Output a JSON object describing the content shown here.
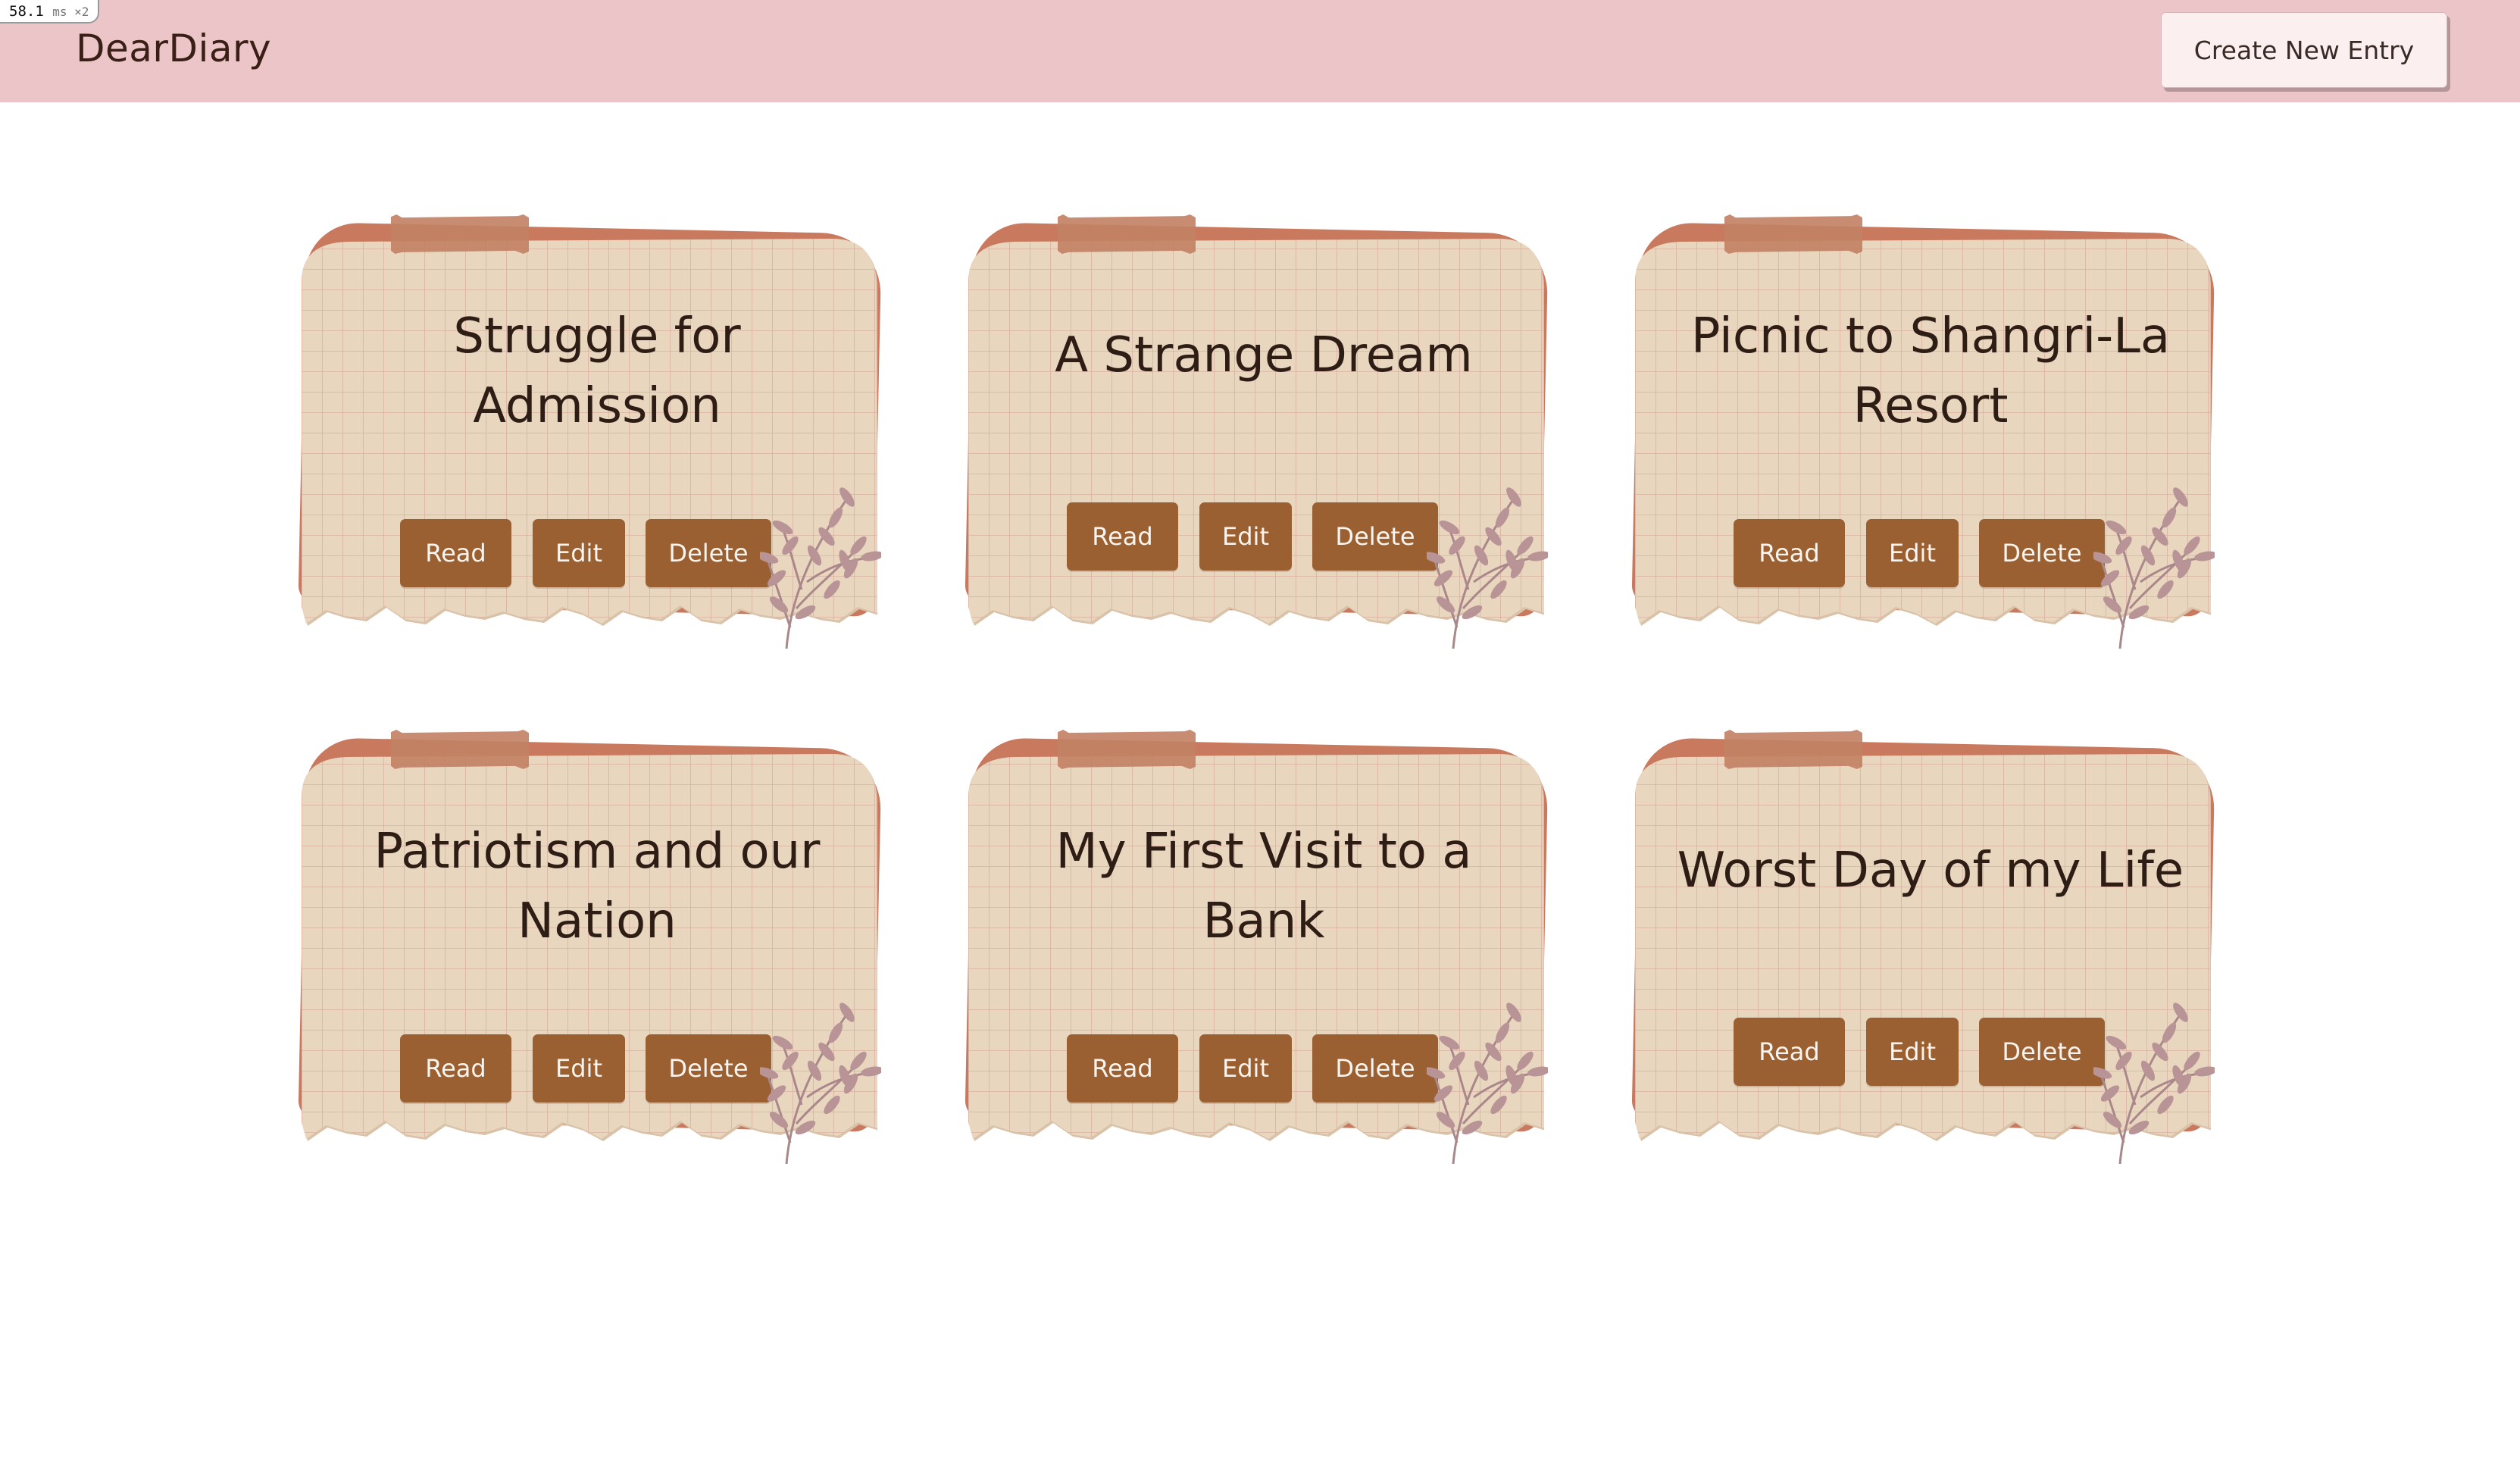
{
  "perf": {
    "value": "58.1",
    "unit": "ms ×2"
  },
  "navbar": {
    "brand": "DearDiary",
    "create_label": "Create New Entry"
  },
  "entries": [
    {
      "title": "Struggle for Admission",
      "read": "Read",
      "edit": "Edit",
      "delete": "Delete"
    },
    {
      "title": "A Strange Dream",
      "read": "Read",
      "edit": "Edit",
      "delete": "Delete"
    },
    {
      "title": "Picnic to Shangri-La Resort",
      "read": "Read",
      "edit": "Edit",
      "delete": "Delete"
    },
    {
      "title": "Patriotism and our Nation",
      "read": "Read",
      "edit": "Edit",
      "delete": "Delete"
    },
    {
      "title": "My First Visit to a Bank",
      "read": "Read",
      "edit": "Edit",
      "delete": "Delete"
    },
    {
      "title": "Worst Day of my Life",
      "read": "Read",
      "edit": "Edit",
      "delete": "Delete"
    }
  ],
  "colors": {
    "navbar_bg": "#ecc5c8",
    "paper_bg": "#e9d6bf",
    "grid_line": "#d7a99b",
    "button_bg": "#9a6031",
    "tape": "#c28265",
    "page_back": "#c9795e",
    "title_text": "#2e1d14"
  },
  "icons": {
    "decoration": "leaf-sprig-icon"
  }
}
